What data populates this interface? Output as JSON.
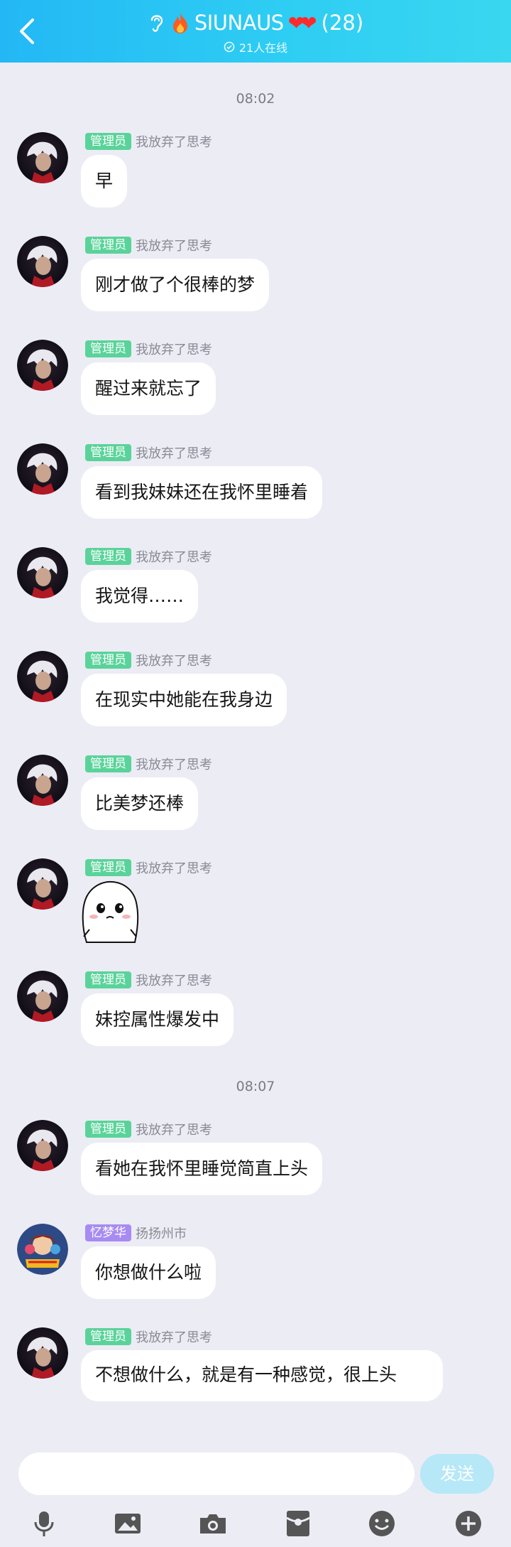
{
  "header": {
    "group_name": "SIUNAUS",
    "hearts": "❤❤",
    "member_count": "(28)",
    "online": "21人在线"
  },
  "timestamps": [
    "08:02",
    "08:07"
  ],
  "messages": [
    {
      "badge": "管理员",
      "name": "我放弃了思考",
      "text": "早"
    },
    {
      "badge": "管理员",
      "name": "我放弃了思考",
      "text": "刚才做了个很棒的梦"
    },
    {
      "badge": "管理员",
      "name": "我放弃了思考",
      "text": "醒过来就忘了"
    },
    {
      "badge": "管理员",
      "name": "我放弃了思考",
      "text": "看到我妹妹还在我怀里睡着"
    },
    {
      "badge": "管理员",
      "name": "我放弃了思考",
      "text": "我觉得……"
    },
    {
      "badge": "管理员",
      "name": "我放弃了思考",
      "text": "在现实中她能在我身边"
    },
    {
      "badge": "管理员",
      "name": "我放弃了思考",
      "text": "比美梦还棒"
    },
    {
      "badge": "管理员",
      "name": "我放弃了思考",
      "sticker": "crying-face-sticker"
    },
    {
      "badge": "管理员",
      "name": "我放弃了思考",
      "text": "妹控属性爆发中"
    },
    {
      "badge": "管理员",
      "name": "我放弃了思考",
      "text": "看她在我怀里睡觉简直上头"
    },
    {
      "badge": "忆梦华",
      "name": "扬扬州市",
      "text": "你想做什么啦"
    },
    {
      "badge": "管理员",
      "name": "我放弃了思考",
      "text": "不想做什么，就是有一种感觉，很上头"
    }
  ],
  "input": {
    "placeholder": "",
    "send_label": "发送"
  },
  "toolbar": [
    "microphone-icon",
    "image-icon",
    "camera-icon",
    "red-packet-icon",
    "emoji-icon",
    "plus-icon"
  ],
  "colors": {
    "header_start": "#23b8f5",
    "header_end": "#3ad7f0",
    "admin_badge": "#5ad39a",
    "member_badge": "#a78bf2",
    "send_button": "#b6e8f7",
    "background": "#ececf5"
  }
}
